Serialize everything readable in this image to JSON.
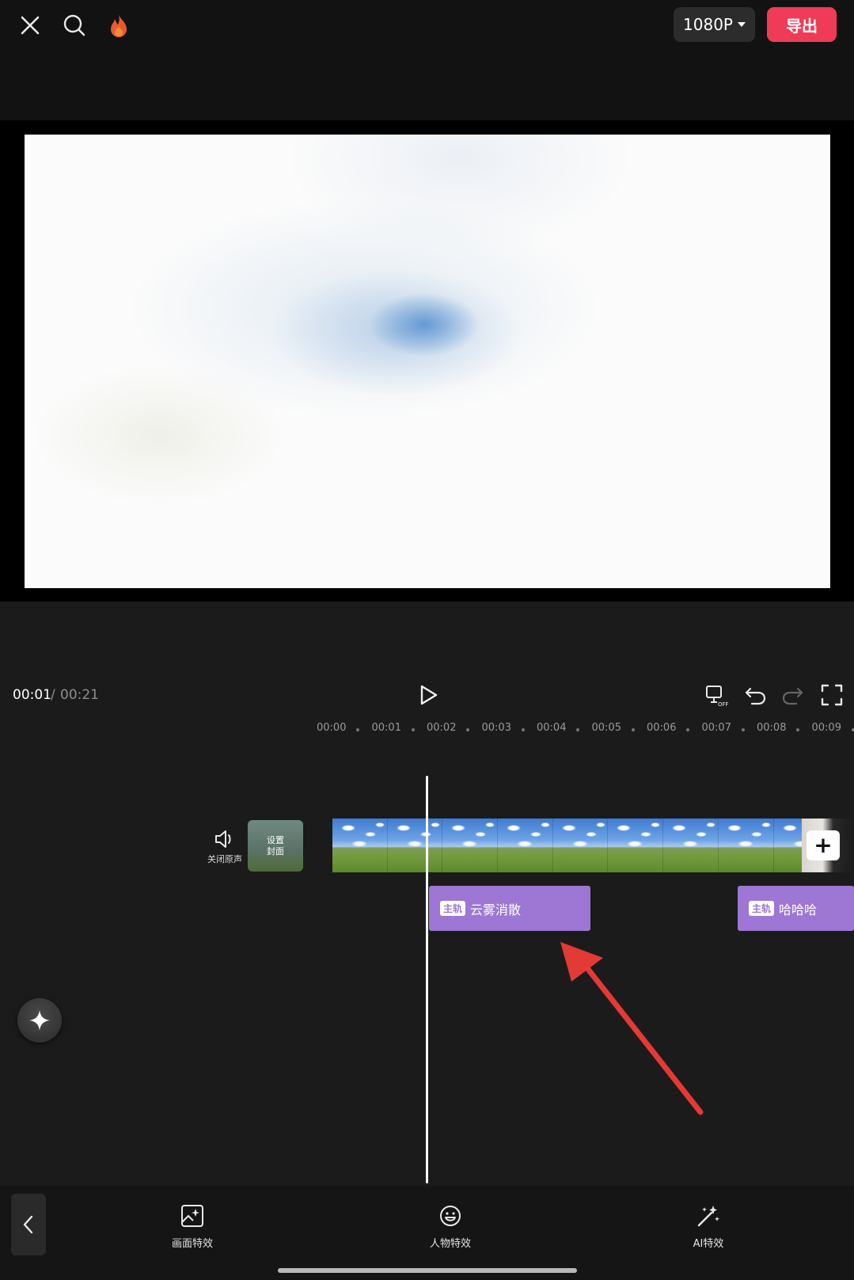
{
  "header": {
    "resolution_label": "1080P",
    "export_label": "导出"
  },
  "playback": {
    "current_time": "00:01",
    "separator": "/",
    "total_time": "00:21"
  },
  "ruler": {
    "labels": [
      "00:00",
      "00:01",
      "00:02",
      "00:03",
      "00:04",
      "00:05",
      "00:06",
      "00:07",
      "00:08",
      "00:09"
    ]
  },
  "track": {
    "mute_label": "关闭原声",
    "cover_label_line1": "设置",
    "cover_label_line2": "封面",
    "add_label": "+"
  },
  "effects": [
    {
      "tag": "主轨",
      "name": "云雾消散"
    },
    {
      "tag": "主轨",
      "name": "哈哈哈"
    }
  ],
  "toolbar": {
    "items": [
      {
        "label": "画面特效",
        "icon": "image-effect-icon"
      },
      {
        "label": "人物特效",
        "icon": "face-effect-icon"
      },
      {
        "label": "AI特效",
        "icon": "ai-magic-wand-icon"
      }
    ]
  },
  "colors": {
    "accent": "#ef3b57",
    "effect_clip": "#9d77d3",
    "annotation_arrow": "#e53935"
  }
}
